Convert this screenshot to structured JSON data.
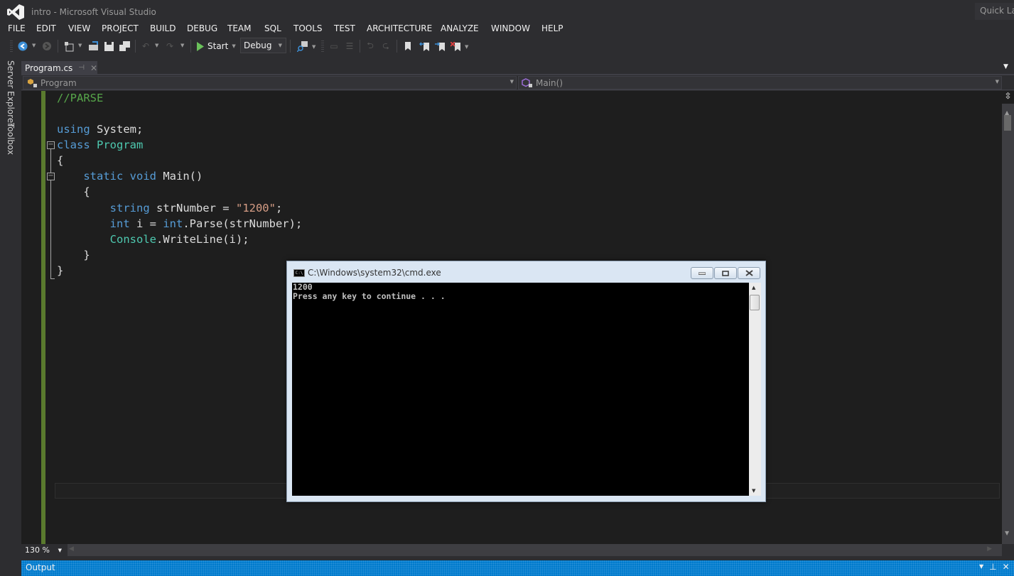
{
  "window": {
    "title": "intro - Microsoft Visual Studio",
    "quick_launch": "Quick Launch"
  },
  "menu": [
    "FILE",
    "EDIT",
    "VIEW",
    "PROJECT",
    "BUILD",
    "DEBUG",
    "TEAM",
    "SQL",
    "TOOLS",
    "TEST",
    "ARCHITECTURE",
    "ANALYZE",
    "WINDOW",
    "HELP"
  ],
  "toolbar": {
    "start_label": "Start",
    "configuration": "Debug"
  },
  "sidebar": {
    "server_explorer": "Server Explorer",
    "toolbox": "Toolbox"
  },
  "tabs": [
    {
      "label": "Program.cs",
      "active": true
    }
  ],
  "navbar": {
    "type": "Program",
    "member": "Main()"
  },
  "code": {
    "line1": "//PARSE",
    "using_kw": "using",
    "using_rest": " System;",
    "class_kw": "class",
    "class_name": "Program",
    "open1": "{",
    "static_kw": "static",
    "void_kw": "void",
    "main_sig": "Main()",
    "open2": "{",
    "string_kw": "string",
    "strnum_decl": " strNumber = ",
    "str_lit": "\"1200\"",
    "semi": ";",
    "int_kw": "int",
    "i_decl": " i = ",
    "int_kw2": "int",
    "parse_call": ".Parse(strNumber);",
    "console_type": "Console",
    "writeline_call": ".WriteLine(i);",
    "close2": "}",
    "close1": "}"
  },
  "editor": {
    "zoom": "130 %"
  },
  "output_panel": {
    "title": "Output"
  },
  "console": {
    "title": "C:\\Windows\\system32\\cmd.exe",
    "output": "1200\nPress any key to continue . . ."
  },
  "colors": {
    "accent": "#007acc",
    "keyword": "#569cd6",
    "type": "#4ec9b0",
    "comment": "#57a64a",
    "string": "#d69d85"
  }
}
